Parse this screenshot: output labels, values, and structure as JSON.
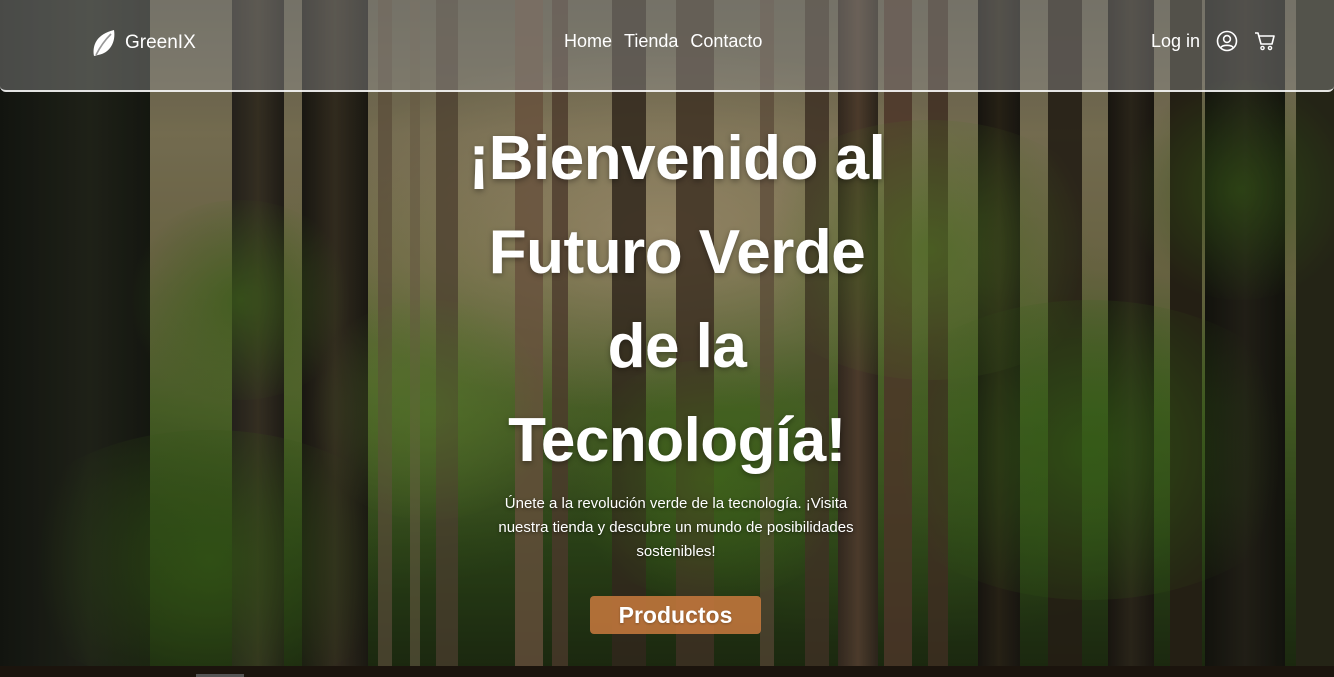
{
  "brand": {
    "name": "GreenIX",
    "icon": "leaf-icon"
  },
  "nav": {
    "links": [
      "Home",
      "Tienda",
      "Contacto"
    ],
    "login_label": "Log in",
    "user_icon": "user-circle-icon",
    "cart_icon": "shopping-cart-icon"
  },
  "hero": {
    "title": "¡Bienvenido al Futuro Verde de la Tecnología!",
    "subtitle": "Únete a la revolución verde de la tecnología. ¡Visita nuestra tienda y descubre un mundo de posibilidades sostenibles!",
    "cta_label": "Productos",
    "background": "forest-photo"
  },
  "colors": {
    "cta": "#c4783c",
    "navbar": "#969696",
    "text": "#ffffff"
  }
}
